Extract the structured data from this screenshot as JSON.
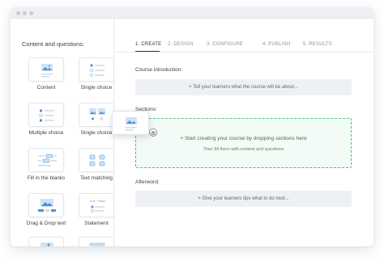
{
  "sidebar": {
    "title": "Content and questions:",
    "items": [
      {
        "label": "Content",
        "icon": "image-text-icon"
      },
      {
        "label": "Single choice",
        "icon": "single-choice-icon"
      },
      {
        "label": "Multiple choice",
        "icon": "multiple-choice-icon"
      },
      {
        "label": "Single choice",
        "icon": "image-single-choice-icon"
      },
      {
        "label": "Fill in the blanks",
        "icon": "fill-blanks-icon"
      },
      {
        "label": "Text matching",
        "icon": "text-matching-icon"
      },
      {
        "label": "Drag & Drop text",
        "icon": "drag-drop-icon"
      },
      {
        "label": "Statement",
        "icon": "true-false-icon",
        "tile_text": "True · False"
      },
      {
        "label": "",
        "icon": "image-hotspot-icon"
      },
      {
        "label": "",
        "icon": "list-icon"
      }
    ]
  },
  "steps": [
    {
      "label": "1. CREATE",
      "active": true
    },
    {
      "label": "2. DESIGN",
      "active": false
    },
    {
      "label": "3. CONFIGURE",
      "active": false
    },
    {
      "label": "4. PUBLISH",
      "active": false
    },
    {
      "label": "5. RESULTS",
      "active": false
    }
  ],
  "course_intro": {
    "label": "Course introduction:",
    "placeholder": "+ Tell your learners what the course will be about..."
  },
  "sections": {
    "label": "Sections:",
    "drop_main": "+ Start creating your course by dropping sections here",
    "drop_sub": "Then fill them with content and questions"
  },
  "afterword": {
    "label": "Afterword:",
    "placeholder": "+ Give your learners tips what to do next..."
  },
  "colors": {
    "accent_blue": "#4a90d9",
    "dropzone_border": "#4cbf7a",
    "panel_gray": "#eef1f4"
  }
}
